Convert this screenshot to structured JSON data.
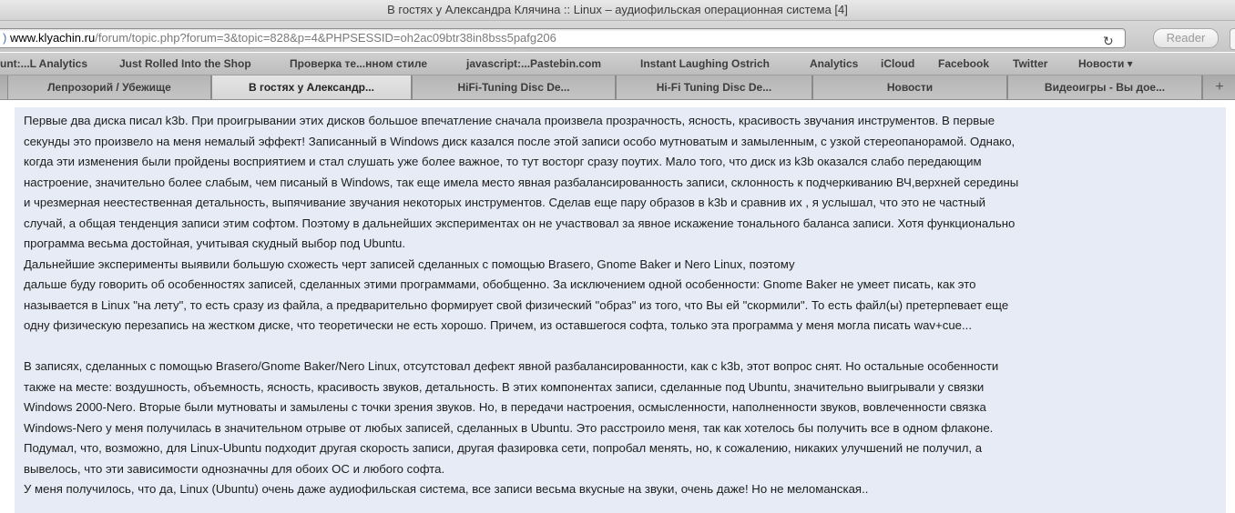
{
  "window": {
    "title": "В гостях у Александра Клячина :: Linux – аудиофильская операционная система [4]"
  },
  "address_bar": {
    "host": "www.klyachin.ru",
    "path": "/forum/topic.php?forum=3&topic=828&p=4&PHPSESSID=oh2ac09btr38in8bss5pafg206",
    "reload_icon": "reload-icon",
    "reader_label": "Reader"
  },
  "bookmarks": [
    "unt:...L Analytics",
    "Just Rolled Into the Shop",
    "Проверка те...нном стиле",
    "javascript:...Pastebin.com",
    "Instant Laughing Ostrich",
    "Analytics",
    "iCloud",
    "Facebook",
    "Twitter",
    "Новости ▾"
  ],
  "tabs": [
    {
      "label": "Лепрозорий / Убежище",
      "active": false
    },
    {
      "label": "В гостях у Александр...",
      "active": true
    },
    {
      "label": "HiFi-Tuning Disc De...",
      "active": false
    },
    {
      "label": "Hi-Fi Tuning Disc De...",
      "active": false
    },
    {
      "label": "Новости",
      "active": false
    },
    {
      "label": "Видеоигры - Вы дое...",
      "active": false
    }
  ],
  "new_tab_label": "+",
  "post": {
    "lines": [
      "Первые два диска писал k3b. При проигрывании этих дисков большое впечатление сначала произвела прозрачность, ясность, красивость звучания инструментов. В первые",
      "секунды это произвело на меня немалый эффект! Записанный в Windows диск казался после этой записи особо мутноватым и замыленным, с узкой стереопанорамой. Однако,",
      "когда эти изменения были пройдены восприятием и стал слушать уже более важное, то тут восторг сразу поутих. Мало того, что диск из k3b оказался слабо передающим",
      "настроение, значительно более слабым, чем писаный в Windows, так еще имела место явная разбалансированность записи, склонность к подчеркиванию ВЧ,верхней середины",
      "и чрезмерная неестественная детальность, выпячивание звучания некоторых инструментов. Сделав еще пару образов в k3b и сравнив их , я услышал, что это не частный",
      "случай, а общая тенденция записи этим софтом. Поэтому в дальнейших экспериментах он не участвовал за явное искажение тонального баланса записи. Хотя функционально",
      "программа весьма достойная, учитывая скудный выбор под Ubuntu.",
      "Дальнейшие эксперименты выявили большую схожесть черт записей сделанных с помощью Brasero, Gnome Baker и Nero Linux, поэтому",
      "дальше буду говорить об особенностях записей, сделанных этими программами, обобщенно. За исключением одной особенности: Gnome Baker не умеет писать, как это",
      "называется в Linux \"на лету\", то есть сразу из файла, а предварительно формирует свой физический \"образ\" из того, что Вы ей \"скормили\". То есть файл(ы) претерпевает еще",
      "одну физическую перезапись на жестком диске, что теоретически не есть хорошо. Причем, из оставшегося софта, только эта программа у меня могла писать wav+cue...",
      "",
      "В записях, сделанных с помощью Brasero/Gnome Baker/Nero Linux, отсутстовал дефект явной разбалансированности, как с k3b, этот вопрос снят. Но остальные особенности",
      "также на месте: воздушность, объемность, ясность, красивость звуков, детальность. В этих компонентах записи, сделанные под Ubuntu, значительно выигрывали у связки",
      "Windows 2000-Nero. Вторые были мутноваты и замылены с точки зрения звуков. Но, в передачи настроения, осмысленности, наполненности звуков, вовлеченности связка",
      "Windows-Nero у меня получилась в значительном отрыве от любых записей, сделанных в Ubuntu. Это расстроило меня, так как хотелось бы получить все в одном флаконе.",
      "Подумал, что, возможно, для Linux-Ubuntu подходит другая скорость записи, другая фазировка сети, попробал менять, но, к сожалению, никаких улучшений не получил, а",
      "вывелось, что эти зависимости однозначны для обоих ОС и любого софта.",
      "У меня получилось, что да, Linux (Ubuntu) очень даже аудиофильская система, все записи весьма вкусные на звуки, очень даже! Но не меломанская.."
    ]
  }
}
